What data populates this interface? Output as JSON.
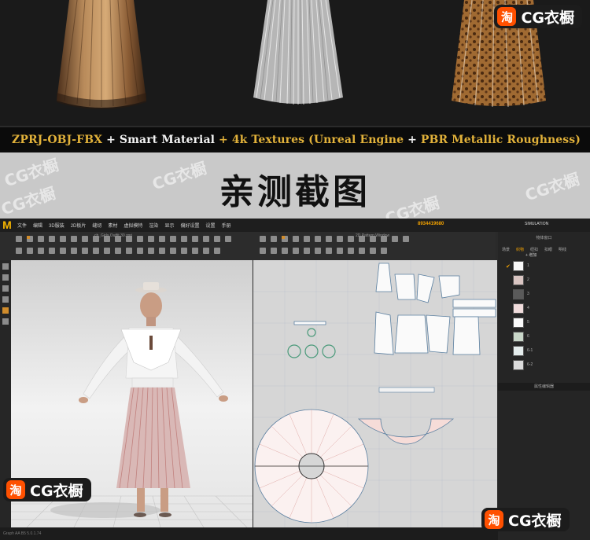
{
  "banner": {
    "format_line": [
      {
        "text": "ZPRJ-OBJ-FBX",
        "color": "#e1b13a"
      },
      {
        "text": " + ",
        "color": "#f2f2f2"
      },
      {
        "text": "Smart Material",
        "color": "#f2f2f2"
      },
      {
        "text": " + ",
        "color": "#e1b13a"
      },
      {
        "text": "4k Textures (Unreal Engine",
        "color": "#e1b13a"
      },
      {
        "text": " + ",
        "color": "#f2f2f2"
      },
      {
        "text": "PBR Metallic Roughness)",
        "color": "#e1b13a"
      }
    ],
    "heading": "亲测截图",
    "watermark": "CG衣橱"
  },
  "badges": {
    "tao_glyph": "淘",
    "text": "CG衣橱"
  },
  "app": {
    "logo": "M",
    "menu": [
      "文件",
      "编辑",
      "3D服装",
      "2D板片",
      "缝纫",
      "素材",
      "虚拟模特",
      "渲染",
      "显示",
      "偏好设置",
      "设置",
      "手册"
    ],
    "serial": "8934419680",
    "simulation_label": "SIMULATION",
    "tab_3d": "ch_Girls Outfit 30.zprj",
    "tab_2d": "2D Pattern Window",
    "panel_title": "物体窗口",
    "panel_tabs": [
      "场景",
      "织物",
      "纽扣",
      "扣眼",
      "明线"
    ],
    "add_label": "+ 增加",
    "fabrics": [
      {
        "label": "1",
        "color": "#f7f7f7"
      },
      {
        "label": "2",
        "color": "#d9c5c2"
      },
      {
        "label": "3",
        "color": "#5a5a5a"
      },
      {
        "label": "4",
        "color": "#f0dcdc"
      },
      {
        "label": "5",
        "color": "#fafafa"
      },
      {
        "label": "6",
        "color": "#c8d6c8"
      },
      {
        "label": "6-1",
        "color": "#e4ecec"
      },
      {
        "label": "6-2",
        "color": "#dcdcdc"
      }
    ],
    "editor_title": "属性编辑器",
    "status": "Graph AA B5 5.0.1.74"
  }
}
